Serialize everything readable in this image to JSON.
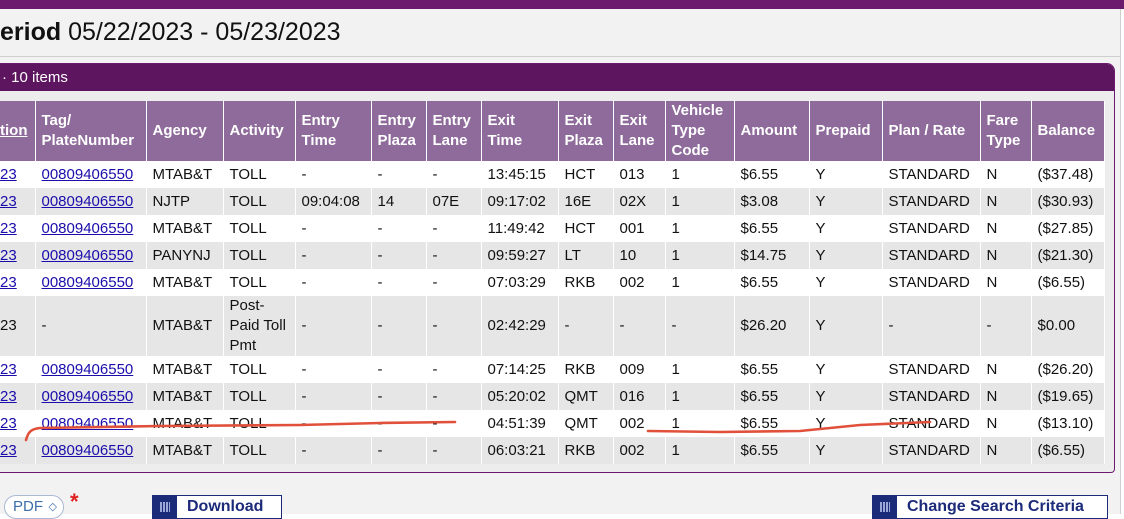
{
  "period": {
    "label": "eriod",
    "range": "05/22/2023 - 05/23/2023"
  },
  "panel": {
    "header": "· 10 items"
  },
  "table": {
    "columns": [
      "tion",
      "Tag/ PlateNumber",
      "Agency",
      "Activity",
      "Entry Time",
      "Entry Plaza",
      "Entry Lane",
      "Exit Time",
      "Exit Plaza",
      "Exit Lane",
      "Vehicle Type Code",
      "Amount",
      "Prepaid",
      "Plan / Rate",
      "Fare Type",
      "Balance"
    ],
    "rows": [
      [
        "23",
        "00809406550",
        "MTAB&T",
        "TOLL",
        "-",
        "-",
        "-",
        "13:45:15",
        "HCT",
        "013",
        "1",
        "$6.55",
        "Y",
        "STANDARD",
        "N",
        "($37.48)"
      ],
      [
        "23",
        "00809406550",
        "NJTP",
        "TOLL",
        "09:04:08",
        "14",
        "07E",
        "09:17:02",
        "16E",
        "02X",
        "1",
        "$3.08",
        "Y",
        "STANDARD",
        "N",
        "($30.93)"
      ],
      [
        "23",
        "00809406550",
        "MTAB&T",
        "TOLL",
        "-",
        "-",
        "-",
        "11:49:42",
        "HCT",
        "001",
        "1",
        "$6.55",
        "Y",
        "STANDARD",
        "N",
        "($27.85)"
      ],
      [
        "23",
        "00809406550",
        "PANYNJ",
        "TOLL",
        "-",
        "-",
        "-",
        "09:59:27",
        "LT",
        "10",
        "1",
        "$14.75",
        "Y",
        "STANDARD",
        "N",
        "($21.30)"
      ],
      [
        "23",
        "00809406550",
        "MTAB&T",
        "TOLL",
        "-",
        "-",
        "-",
        "07:03:29",
        "RKB",
        "002",
        "1",
        "$6.55",
        "Y",
        "STANDARD",
        "N",
        "($6.55)"
      ],
      [
        "23",
        "-",
        "MTAB&T",
        "Post- Paid Toll Pmt",
        "-",
        "-",
        "-",
        "02:42:29",
        "-",
        "-",
        "-",
        "$26.20",
        "Y",
        "-",
        "-",
        "$0.00"
      ],
      [
        "23",
        "00809406550",
        "MTAB&T",
        "TOLL",
        "-",
        "-",
        "-",
        "07:14:25",
        "RKB",
        "009",
        "1",
        "$6.55",
        "Y",
        "STANDARD",
        "N",
        "($26.20)"
      ],
      [
        "23",
        "00809406550",
        "MTAB&T",
        "TOLL",
        "-",
        "-",
        "-",
        "05:20:02",
        "QMT",
        "016",
        "1",
        "$6.55",
        "Y",
        "STANDARD",
        "N",
        "($19.65)"
      ],
      [
        "23",
        "00809406550",
        "MTAB&T",
        "TOLL",
        "-",
        "-",
        "-",
        "04:51:39",
        "QMT",
        "002",
        "1",
        "$6.55",
        "Y",
        "STANDARD",
        "N",
        "($13.10)"
      ],
      [
        "23",
        "00809406550",
        "MTAB&T",
        "TOLL",
        "-",
        "-",
        "-",
        "06:03:21",
        "RKB",
        "002",
        "1",
        "$6.55",
        "Y",
        "STANDARD",
        "N",
        "($6.55)"
      ]
    ]
  },
  "footer": {
    "format": "PDF",
    "required_mark": "*",
    "download_label": "Download",
    "change_label": "Change Search Criteria"
  },
  "colors": {
    "brand_purple": "#6b1a6e",
    "header_cell": "#8e6b9a",
    "link": "#1a0dab",
    "annotation_red": "#e0503a"
  }
}
